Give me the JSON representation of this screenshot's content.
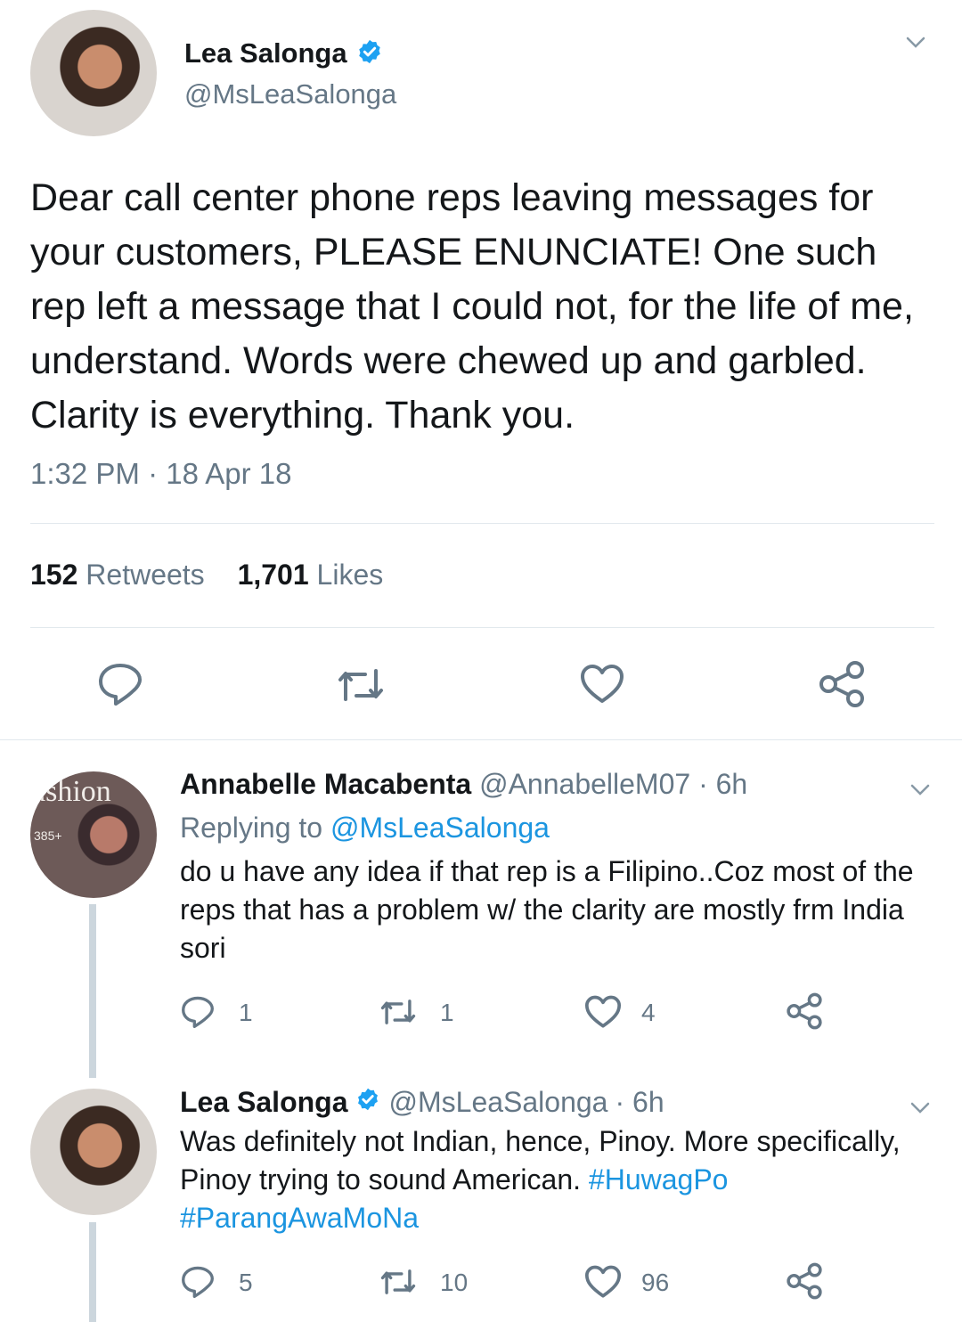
{
  "main_tweet": {
    "author_name": "Lea Salonga",
    "author_handle": "@MsLeaSalonga",
    "text": "Dear call center phone reps leaving messages for your customers, PLEASE ENUNCIATE! One such rep left a message that I could not, for the life of me, understand. Words were chewed up and garbled. Clarity is everything. Thank you.",
    "timestamp": "1:32 PM · 18 Apr 18",
    "retweet_count": "152",
    "retweet_label": "Retweets",
    "like_count": "1,701",
    "like_label": "Likes"
  },
  "replies": [
    {
      "author_name": "Annabelle Macabenta",
      "author_handle": "@AnnabelleM07",
      "age": "· 6h",
      "replying_prefix": "Replying to",
      "replying_to": "@MsLeaSalonga",
      "text": "do u have any idea if that rep is a Filipino..Coz most of the reps that has a problem w/ the clarity are mostly frm India sori",
      "reply_count": "1",
      "retweet_count": "1",
      "like_count": "4"
    },
    {
      "author_name": "Lea Salonga",
      "author_handle": "@MsLeaSalonga",
      "age": "· 6h",
      "text_plain": "Was definitely not Indian, hence, Pinoy. More specifically, Pinoy trying to sound American.",
      "hashtag_1": "#HuwagPo",
      "hashtag_2": "#ParangAwaMoNa",
      "reply_count": "5",
      "retweet_count": "10",
      "like_count": "96"
    }
  ],
  "avatar_badge_text": "ashion",
  "avatar_badge_small": "385+",
  "colors": {
    "link": "#1b95e0",
    "muted": "#657786",
    "verified": "#1da1f2",
    "icon": "#657786",
    "thread_line": "#ccd6dd"
  },
  "icons": [
    "chevron-down-icon",
    "verified-badge-icon",
    "reply-icon",
    "retweet-icon",
    "like-icon",
    "share-icon"
  ]
}
